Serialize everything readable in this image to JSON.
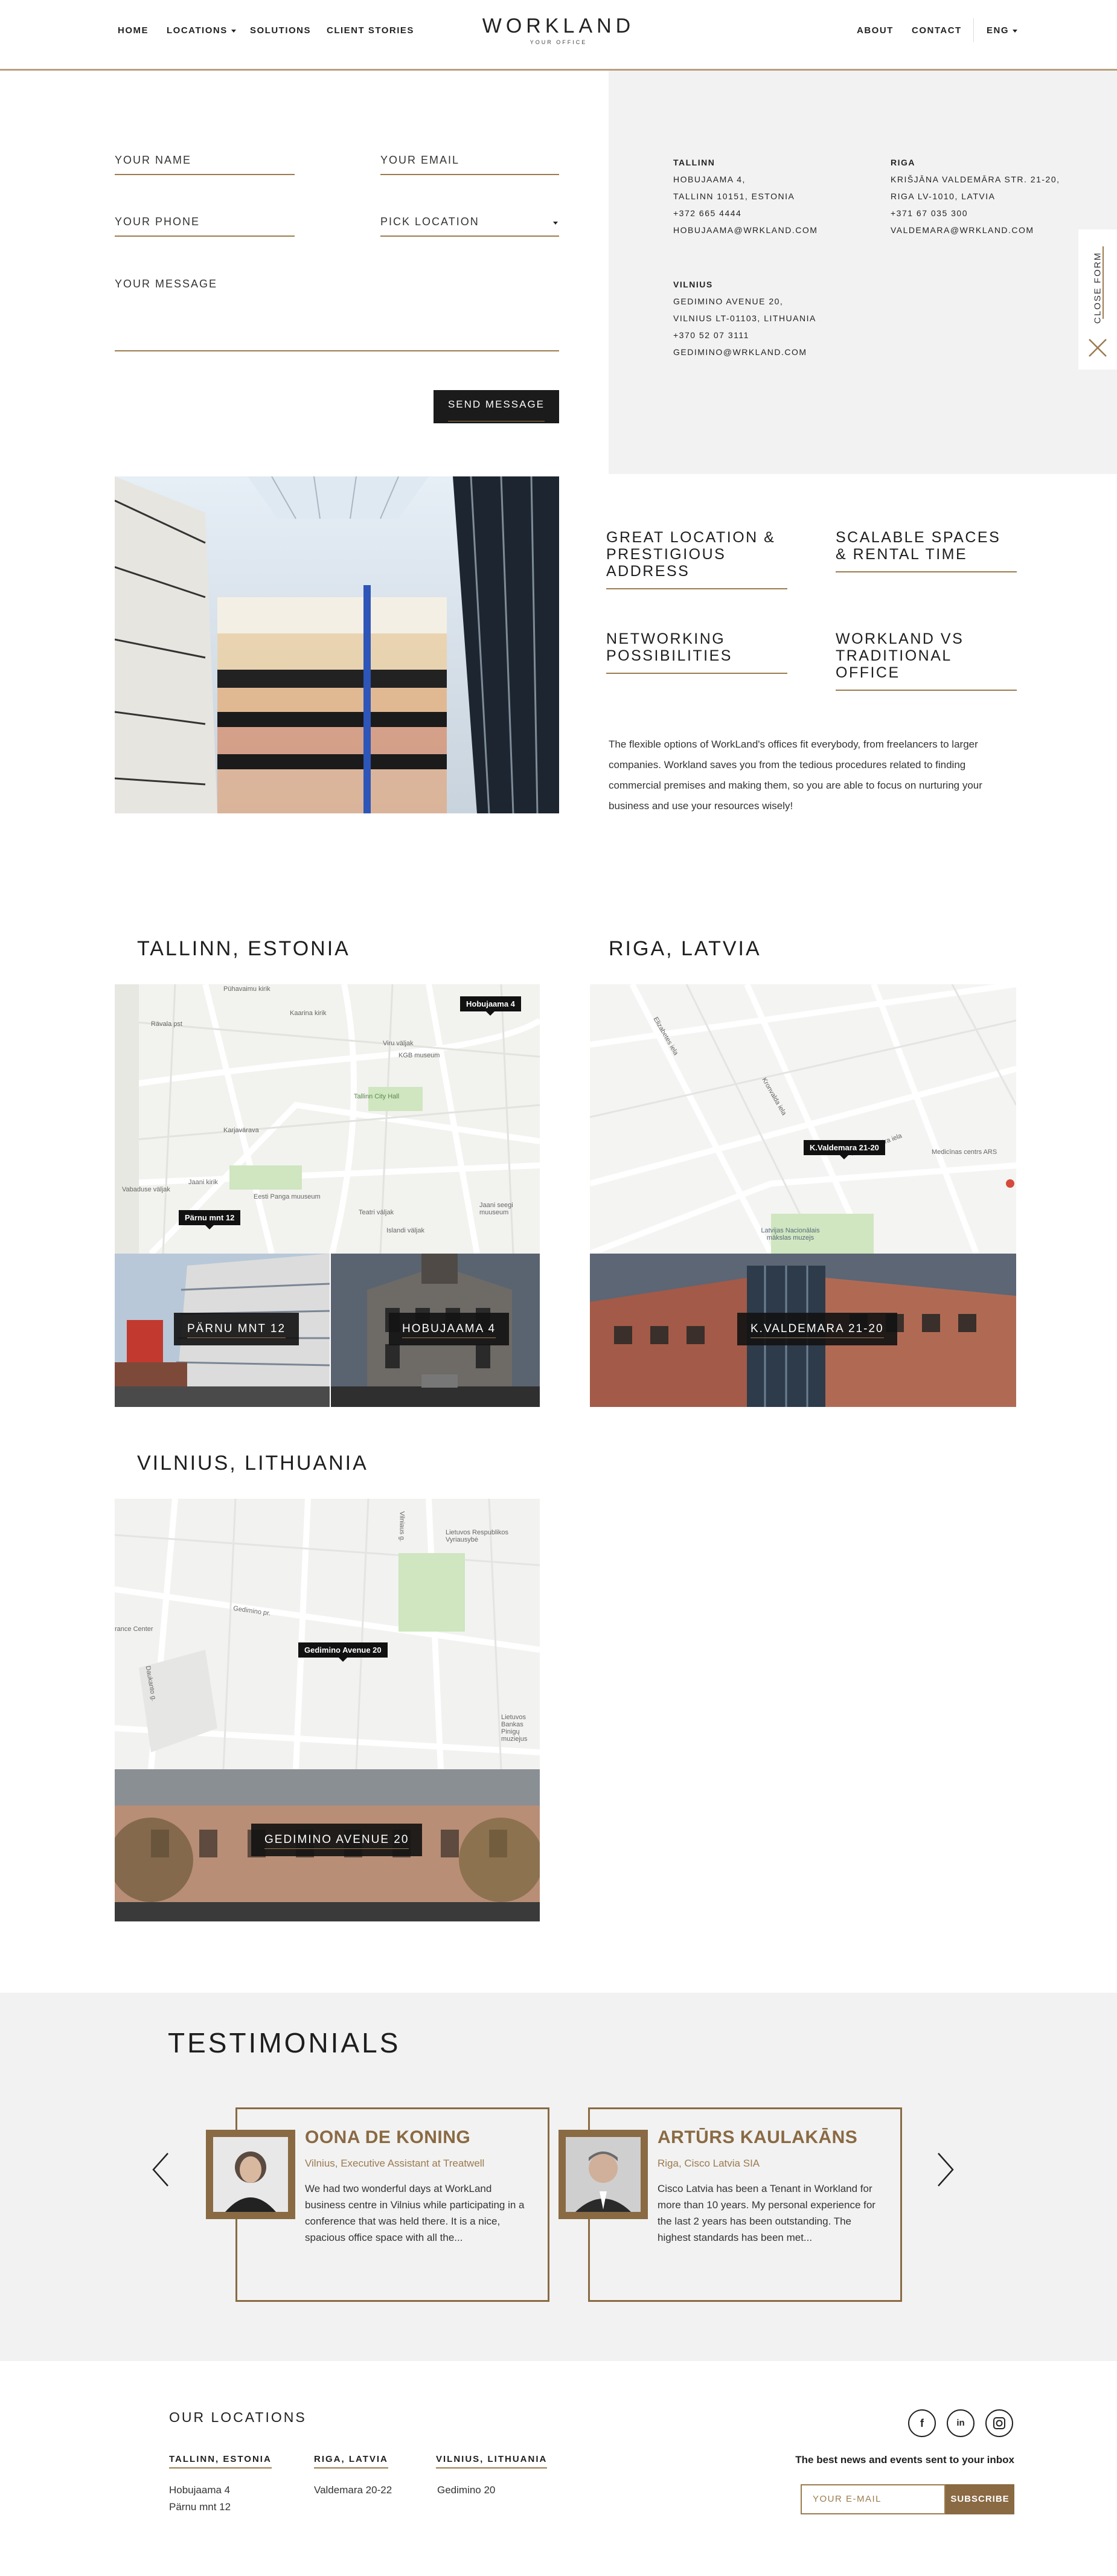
{
  "nav": {
    "home": "HOME",
    "locations": "LOCATIONS",
    "solutions": "SOLUTIONS",
    "client_stories": "CLIENT STORIES",
    "about": "ABOUT",
    "contact": "CONTACT",
    "language": "ENG"
  },
  "logo": {
    "main": "WORKLAND",
    "tagline": "YOUR OFFICE"
  },
  "form": {
    "name": "YOUR NAME",
    "email": "YOUR EMAIL",
    "phone": "YOUR PHONE",
    "location": "PICK LOCATION",
    "message": "YOUR MESSAGE",
    "submit": "SEND MESSAGE"
  },
  "offices": {
    "tallinn": {
      "title": "TALLINN",
      "lines": [
        "HOBUJAAMA 4,",
        "TALLINN 10151, ESTONIA",
        "+372 665 4444",
        "HOBUJAAMA@WRKLAND.COM"
      ]
    },
    "riga": {
      "title": "RIGA",
      "lines": [
        "KRIŠJĀNA VALDEMĀRA STR. 21-20,",
        "RIGA LV-1010, LATVIA",
        "+371 67 035 300",
        "VALDEMARA@WRKLAND.COM"
      ]
    },
    "vilnius": {
      "title": "VILNIUS",
      "lines": [
        "GEDIMINO AVENUE 20,",
        "VILNIUS LT-01103, LITHUANIA",
        "+370 52 07 3111",
        "GEDIMINO@WRKLAND.COM"
      ]
    }
  },
  "close_form": "CLOSE FORM",
  "features": [
    "GREAT LOCATION & PRESTIGIOUS ADDRESS",
    "SCALABLE SPACES & RENTAL TIME",
    "NETWORKING POSSIBILITIES",
    "WORKLAND VS TRADITIONAL OFFICE"
  ],
  "intro": "The flexible options of WorkLand's offices fit everybody, from freelancers to larger companies. Workland saves you from the tedious procedures related to finding commercial premises and making them, so you are able to focus on nurturing your business and use your resources wisely!",
  "cities": {
    "tallinn": {
      "title": "TALLINN, ESTONIA",
      "pin1": "Hobujaama 4",
      "pin2": "Pärnu mnt 12",
      "photo1": "PÄRNU MNT 12",
      "photo2": "HOBUJAAMA 4"
    },
    "riga": {
      "title": "RIGA, LATVIA",
      "pin": "K.Valdemara 21-20",
      "photo": "K.VALDEMARA 21-20"
    },
    "vilnius": {
      "title": "VILNIUS, LITHUANIA",
      "pin": "Gedimino Avenue 20",
      "photo": "GEDIMINO AVENUE 20"
    }
  },
  "map_labels": {
    "t1": "Pühavaimu kirik",
    "t2": "Kaarina kirik",
    "t3": "Rävala pst",
    "t4": "KGB museum",
    "t5": "Viru väljak",
    "t6": "Tallinn City Hall",
    "t7": "Karjavärava",
    "t8": "Jaani kirik",
    "t9": "Vabaduse väljak",
    "t10": "Eesti Panga muuseum",
    "t11": "Teatri väljak",
    "t12": "Islandi väljak",
    "t13": "Jaani seegi muuseum",
    "r1": "Elizabetes iela",
    "r2": "Kr. Valdemāra iela",
    "r3": "Medicīnas centrs ARS",
    "r4": "Latvijas Nacionālais mākslas muzejs",
    "r5": "Kronvalda iela",
    "v1": "Lietuvos Respublikos Vyriausybė",
    "v2": "Gedimino pr.",
    "v3": "Vilniaus g.",
    "v4": "Lietuvos Bankas Pinigų muziejus",
    "v5": "rance Center",
    "v6": "Daukanto g."
  },
  "testimonials": {
    "title": "TESTIMONIALS",
    "items": [
      {
        "name": "OONA DE KONING",
        "role": "Vilnius, Executive Assistant at Treatwell",
        "text": "We had two wonderful days at WorkLand business centre in Vilnius while participating in a conference that was held there. It is a nice, spacious office space with all the..."
      },
      {
        "name": "ARTŪRS KAULAKĀNS",
        "role": "Riga, Cisco Latvia SIA",
        "text": "Cisco Latvia has been a Tenant in Workland for more than 10 years. My personal experience for the last 2 years has been outstanding. The highest standards has been met..."
      }
    ]
  },
  "footer": {
    "title": "OUR LOCATIONS",
    "cities": [
      {
        "name": "TALLINN, ESTONIA",
        "addresses": [
          "Hobujaama 4",
          "Pärnu mnt 12"
        ]
      },
      {
        "name": "RIGA, LATVIA",
        "addresses": [
          "Valdemara 20-22"
        ]
      },
      {
        "name": "VILNIUS, LITHUANIA",
        "addresses": [
          "Gedimino 20"
        ]
      }
    ],
    "newsletter": "The best news and events sent to your inbox",
    "email_placeholder": "YOUR E-MAIL",
    "subscribe": "SUBSCRIBE",
    "social": [
      "facebook-icon",
      "linkedin-icon",
      "instagram-icon"
    ]
  },
  "colors": {
    "accent": "#9c7b4f",
    "brown": "#8a6a43",
    "dark": "#1b1b1b",
    "light_bg": "#f2f2f2"
  }
}
